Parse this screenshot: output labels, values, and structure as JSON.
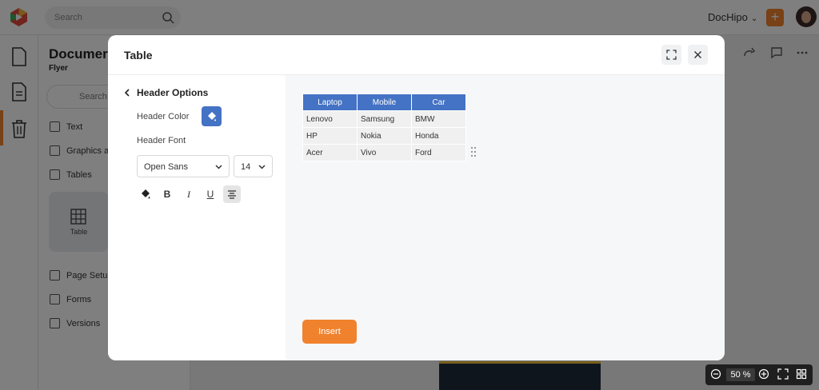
{
  "topbar": {
    "search_placeholder": "Search",
    "brand_label": "DocHipo",
    "plus_label": "+"
  },
  "panel": {
    "doc_title": "Documer",
    "doc_subtitle": "Flyer",
    "search_placeholder": "Search W",
    "items": [
      {
        "label": "Text",
        "icon": "text-icon"
      },
      {
        "label": "Graphics a",
        "icon": "graphics-icon"
      },
      {
        "label": "Tables",
        "icon": "tables-icon"
      }
    ],
    "tile_label": "Table",
    "bottom_items": [
      {
        "label": "Page Setup",
        "icon": "page-setup-icon"
      },
      {
        "label": "Forms",
        "icon": "forms-icon"
      },
      {
        "label": "Versions",
        "icon": "versions-icon"
      }
    ]
  },
  "zoom": {
    "value": "50",
    "unit": "%"
  },
  "modal": {
    "title": "Table",
    "options": {
      "back_label": "Header Options",
      "header_color_label": "Header Color",
      "header_color": "#4472c4",
      "header_font_label": "Header Font",
      "font_family": "Open Sans",
      "font_size": "14",
      "format_buttons": [
        {
          "label": "",
          "icon": "fill-color-icon"
        },
        {
          "label": "B",
          "icon": "bold-icon"
        },
        {
          "label": "I",
          "icon": "italic-icon"
        },
        {
          "label": "U",
          "icon": "underline-icon"
        },
        {
          "label": "",
          "icon": "align-center-icon"
        }
      ]
    },
    "table": {
      "headers": [
        "Laptop",
        "Mobile",
        "Car"
      ],
      "rows": [
        [
          "Lenovo",
          "Samsung",
          "BMW"
        ],
        [
          "HP",
          "Nokia",
          "Honda"
        ],
        [
          "Acer",
          "Vivo",
          "Ford"
        ]
      ]
    },
    "insert_label": "Insert"
  },
  "colors": {
    "accent": "#f0822d",
    "header_blue": "#4472c4"
  }
}
